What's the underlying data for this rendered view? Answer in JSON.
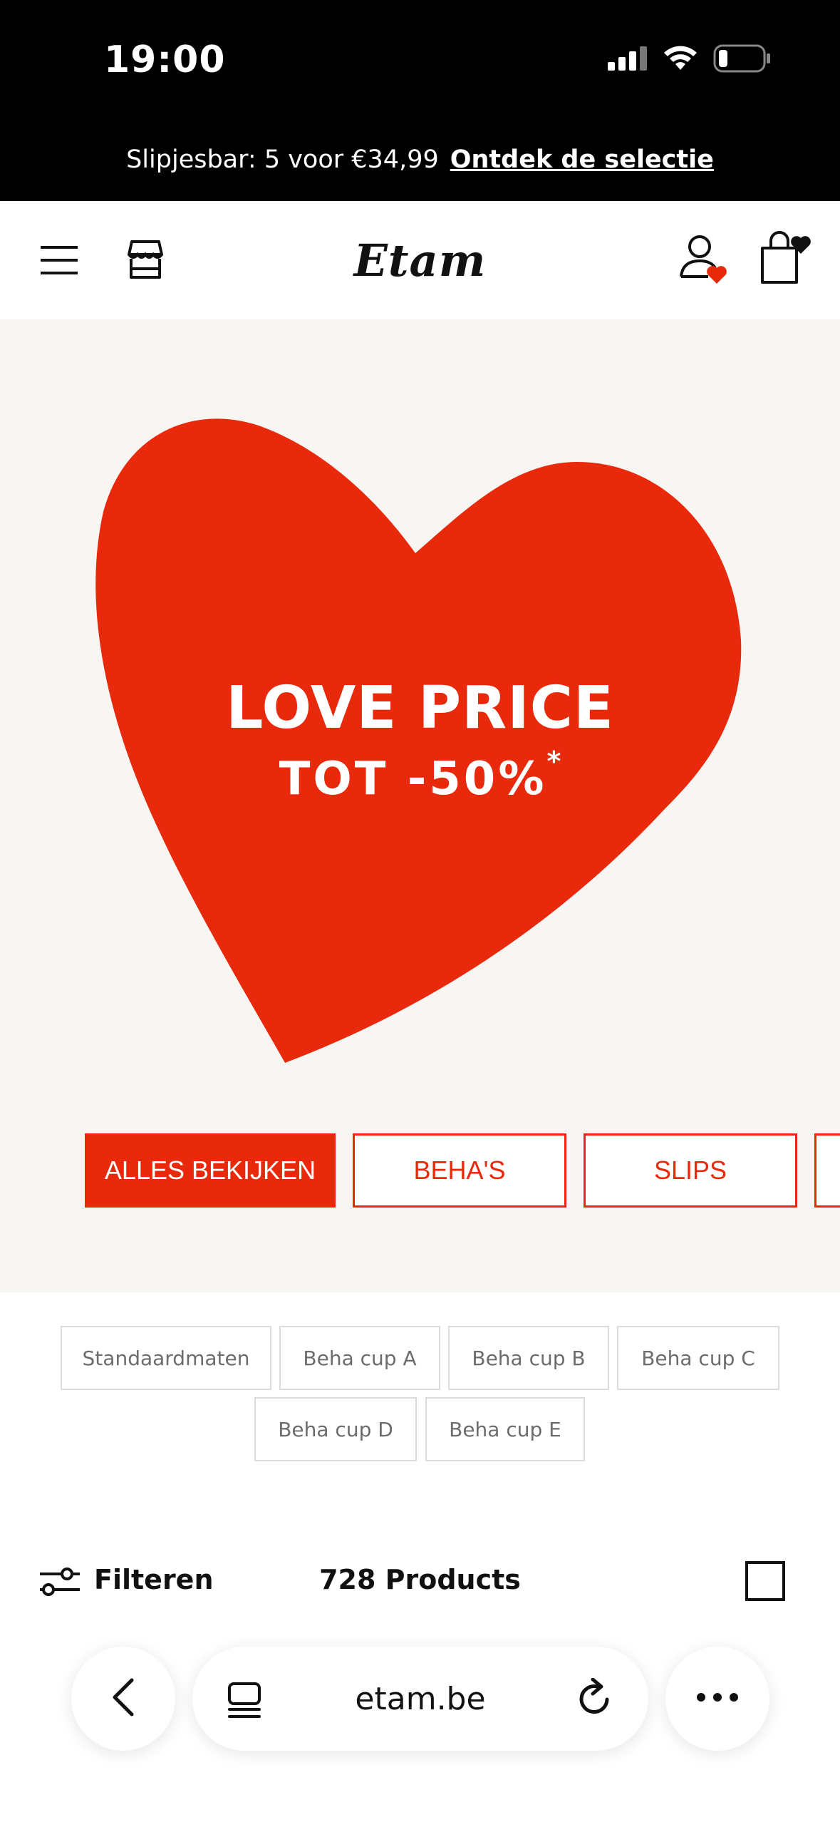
{
  "status_bar": {
    "time": "19:00",
    "icons": [
      "signal-icon",
      "wifi-icon",
      "battery-icon"
    ]
  },
  "promo": {
    "text": "Slipjesbar: 5 voor €34,99",
    "link": "Ontdek de selectie"
  },
  "header": {
    "logo": "Etam",
    "icons": [
      "menu-icon",
      "store-icon",
      "account-icon",
      "bag-icon"
    ]
  },
  "hero": {
    "title": "LOVE PRICE",
    "subtitle": "TOT -50%",
    "asterisk": "*",
    "heart_color": "#e8290b",
    "categories": [
      {
        "label": "ALLES BEKIJKEN",
        "active": true
      },
      {
        "label": "BEHA'S",
        "active": false
      },
      {
        "label": "SLIPS",
        "active": false
      },
      {
        "label": "",
        "active": false
      }
    ]
  },
  "size_chips": [
    "Standaardmaten",
    "Beha cup A",
    "Beha cup B",
    "Beha cup C",
    "Beha cup D",
    "Beha cup E"
  ],
  "filter_bar": {
    "filter_label": "Filteren",
    "product_count": "728 Products"
  },
  "browser": {
    "url": "etam.be",
    "icons": [
      "back-icon",
      "tabs-icon",
      "reload-icon",
      "more-icon"
    ]
  },
  "colors": {
    "accent": "#e8290b",
    "hero_bg": "#f8f6f2",
    "top_bar": "#000000"
  }
}
